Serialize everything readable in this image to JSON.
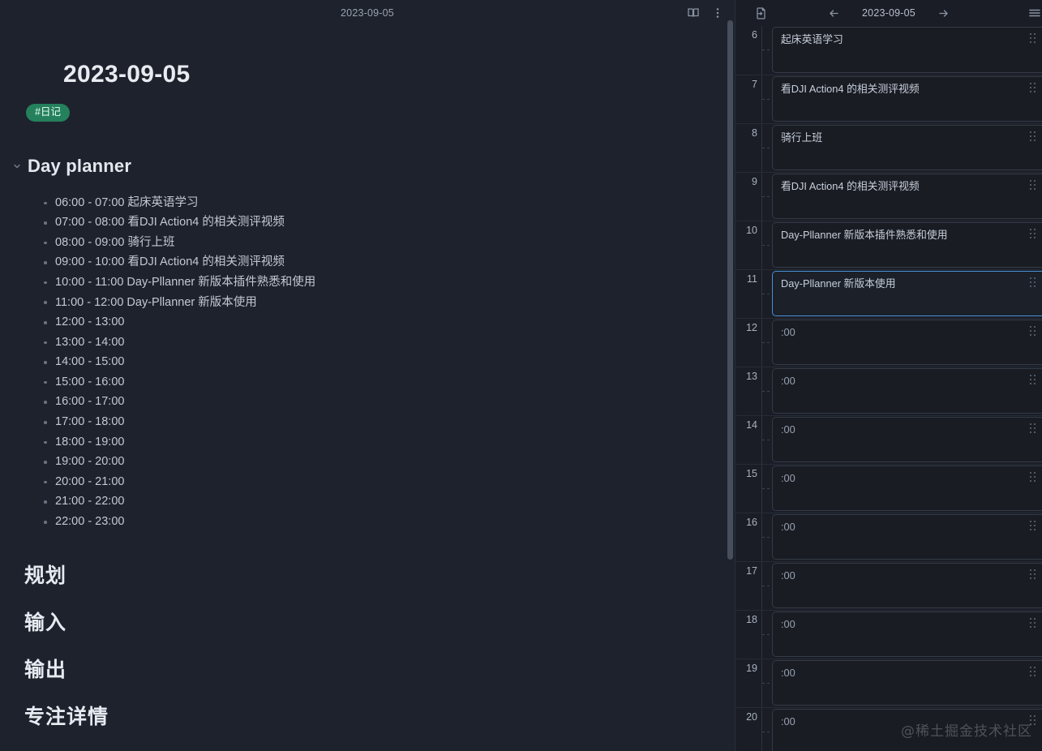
{
  "theme": {
    "bg": "#1e222c",
    "panel_bg": "#1a1d25",
    "card_bg": "#191c23",
    "accent_blue": "#4a90d9",
    "tag_green": "#25805c",
    "text": "#e8ebf0",
    "muted_text": "#9aa3b2"
  },
  "note": {
    "tab_title": "2023-09-05",
    "doc_title": "2023-09-05",
    "tag": "#日记",
    "section_title": "Day planner",
    "planner_items": [
      "06:00 - 07:00 起床英语学习",
      "07:00 - 08:00 看DJI Action4 的相关测评视频",
      "08:00 - 09:00 骑行上班",
      "09:00 - 10:00  看DJI Action4 的相关测评视频",
      "10:00 - 11:00 Day-Pllanner 新版本插件熟悉和使用",
      "11:00 - 12:00  Day-Pllanner 新版本使用",
      "12:00 - 13:00",
      " 13:00 - 14:00",
      "14:00 - 15:00",
      "15:00 - 16:00",
      "16:00 - 17:00",
      "17:00 - 18:00",
      "18:00 - 19:00",
      "19:00 - 20:00",
      "20:00 - 21:00",
      "21:00 - 22:00",
      " 22:00 - 23:00"
    ],
    "headings": [
      "规划",
      "输入",
      "输出",
      "专注详情"
    ],
    "toolbar": {
      "reading_view_icon": "book-icon",
      "more_options_icon": "more-vertical-icon"
    }
  },
  "planner_panel": {
    "date": "2023-09-05",
    "import_icon": "file-import-icon",
    "prev_icon": "arrow-left-icon",
    "next_icon": "arrow-right-icon",
    "menu_icon": "hamburger-menu-icon",
    "rows": [
      {
        "hour": "6",
        "text": "起床英语学习",
        "empty": false,
        "selected": false
      },
      {
        "hour": "7",
        "text": "看DJI Action4 的相关测评视频",
        "empty": false,
        "selected": false
      },
      {
        "hour": "8",
        "text": "骑行上班",
        "empty": false,
        "selected": false
      },
      {
        "hour": "9",
        "text": "看DJI Action4 的相关测评视频",
        "empty": false,
        "selected": false
      },
      {
        "hour": "10",
        "text": "Day-Pllanner 新版本插件熟悉和使用",
        "empty": false,
        "selected": false
      },
      {
        "hour": "11",
        "text": "Day-Pllanner 新版本使用",
        "empty": false,
        "selected": true
      },
      {
        "hour": "12",
        "text": ":00",
        "empty": true,
        "selected": false
      },
      {
        "hour": "13",
        "text": ":00",
        "empty": true,
        "selected": false
      },
      {
        "hour": "14",
        "text": ":00",
        "empty": true,
        "selected": false
      },
      {
        "hour": "15",
        "text": ":00",
        "empty": true,
        "selected": false
      },
      {
        "hour": "16",
        "text": ":00",
        "empty": true,
        "selected": false
      },
      {
        "hour": "17",
        "text": ":00",
        "empty": true,
        "selected": false
      },
      {
        "hour": "18",
        "text": ":00",
        "empty": true,
        "selected": false
      },
      {
        "hour": "19",
        "text": ":00",
        "empty": true,
        "selected": false
      },
      {
        "hour": "20",
        "text": ":00",
        "empty": true,
        "selected": false
      }
    ]
  },
  "watermark": "@稀土掘金技术社区"
}
